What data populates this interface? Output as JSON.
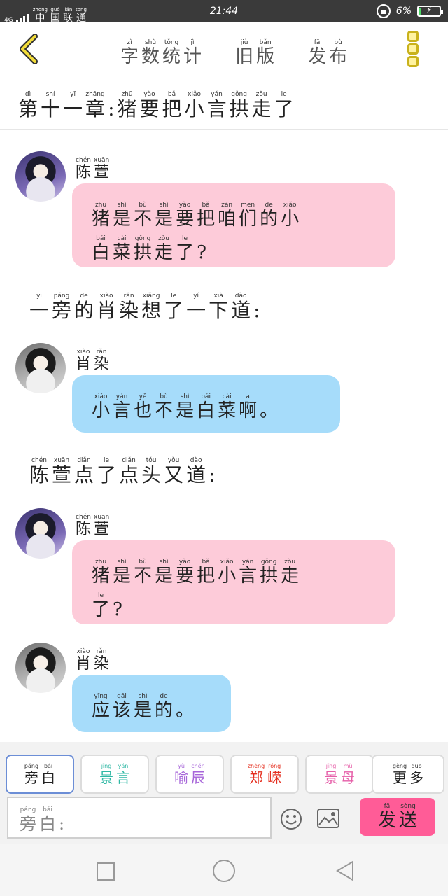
{
  "status_bar": {
    "network": "4G",
    "carrier": [
      {
        "p": "zhōng",
        "c": "中"
      },
      {
        "p": "guó",
        "c": "国"
      },
      {
        "p": "lián",
        "c": "联"
      },
      {
        "p": "tōng",
        "c": "通"
      }
    ],
    "time": "21:44",
    "battery": "6%",
    "battery_level": 0.06
  },
  "header": {
    "actions": [
      {
        "id": "word-count",
        "chars": [
          {
            "p": "zì",
            "c": "字"
          },
          {
            "p": "shù",
            "c": "数"
          },
          {
            "p": "tǒng",
            "c": "统"
          },
          {
            "p": "jì",
            "c": "计"
          }
        ]
      },
      {
        "id": "old-version",
        "chars": [
          {
            "p": "jiù",
            "c": "旧"
          },
          {
            "p": "bǎn",
            "c": "版"
          }
        ]
      },
      {
        "id": "publish",
        "chars": [
          {
            "p": "fā",
            "c": "发"
          },
          {
            "p": "bù",
            "c": "布"
          }
        ]
      }
    ],
    "chapter_title": [
      {
        "p": "dì",
        "c": "第"
      },
      {
        "p": "shí",
        "c": "十"
      },
      {
        "p": "yī",
        "c": "一"
      },
      {
        "p": "zhāng",
        "c": "章"
      },
      {
        "p": "",
        "c": ":"
      },
      {
        "p": "zhū",
        "c": "猪"
      },
      {
        "p": "yào",
        "c": "要"
      },
      {
        "p": "bǎ",
        "c": "把"
      },
      {
        "p": "xiǎo",
        "c": "小"
      },
      {
        "p": "yán",
        "c": "言"
      },
      {
        "p": "gǒng",
        "c": "拱"
      },
      {
        "p": "zǒu",
        "c": "走"
      },
      {
        "p": "le",
        "c": "了"
      }
    ]
  },
  "messages": [
    {
      "type": "chat",
      "color": "pink",
      "avatar": "purple",
      "speaker": [
        {
          "p": "chén",
          "c": "陈"
        },
        {
          "p": "xuān",
          "c": "萱"
        }
      ],
      "lines": [
        [
          {
            "p": "zhū",
            "c": "猪"
          },
          {
            "p": "shì",
            "c": "是"
          },
          {
            "p": "bù",
            "c": "不"
          },
          {
            "p": "shì",
            "c": "是"
          },
          {
            "p": "yào",
            "c": "要"
          },
          {
            "p": "bǎ",
            "c": "把"
          },
          {
            "p": "zán",
            "c": "咱"
          },
          {
            "p": "men",
            "c": "们"
          },
          {
            "p": "de",
            "c": "的"
          },
          {
            "p": "xiǎo",
            "c": "小"
          }
        ],
        [
          {
            "p": "bái",
            "c": "白"
          },
          {
            "p": "cài",
            "c": "菜"
          },
          {
            "p": "gǒng",
            "c": "拱"
          },
          {
            "p": "zǒu",
            "c": "走"
          },
          {
            "p": "le",
            "c": "了"
          },
          {
            "p": "",
            "c": "?"
          }
        ]
      ]
    },
    {
      "type": "narration",
      "lines": [
        [
          {
            "p": "yī",
            "c": "一"
          },
          {
            "p": "páng",
            "c": "旁"
          },
          {
            "p": "de",
            "c": "的"
          },
          {
            "p": "xiào",
            "c": "肖"
          },
          {
            "p": "rǎn",
            "c": "染"
          },
          {
            "p": "xiǎng",
            "c": "想"
          },
          {
            "p": "le",
            "c": "了"
          },
          {
            "p": "yí",
            "c": "一"
          },
          {
            "p": "xià",
            "c": "下"
          },
          {
            "p": "dào",
            "c": "道"
          },
          {
            "p": "",
            "c": ":"
          }
        ]
      ]
    },
    {
      "type": "chat",
      "color": "blue",
      "avatar": "gray",
      "speaker": [
        {
          "p": "xiào",
          "c": "肖"
        },
        {
          "p": "rǎn",
          "c": "染"
        }
      ],
      "lines": [
        [
          {
            "p": "xiǎo",
            "c": "小"
          },
          {
            "p": "yán",
            "c": "言"
          },
          {
            "p": "yě",
            "c": "也"
          },
          {
            "p": "bù",
            "c": "不"
          },
          {
            "p": "shì",
            "c": "是"
          },
          {
            "p": "bái",
            "c": "白"
          },
          {
            "p": "cài",
            "c": "菜"
          },
          {
            "p": "a",
            "c": "啊"
          },
          {
            "p": "",
            "c": "。"
          }
        ]
      ]
    },
    {
      "type": "narration",
      "lines": [
        [
          {
            "p": "chén",
            "c": "陈"
          },
          {
            "p": "xuān",
            "c": "萱"
          },
          {
            "p": "diǎn",
            "c": "点"
          },
          {
            "p": "le",
            "c": "了"
          },
          {
            "p": "diǎn",
            "c": "点"
          },
          {
            "p": "tóu",
            "c": "头"
          },
          {
            "p": "yòu",
            "c": "又"
          },
          {
            "p": "dào",
            "c": "道"
          },
          {
            "p": "",
            "c": ":"
          }
        ]
      ]
    },
    {
      "type": "chat",
      "color": "pink",
      "avatar": "purple",
      "speaker": [
        {
          "p": "chén",
          "c": "陈"
        },
        {
          "p": "xuān",
          "c": "萱"
        }
      ],
      "lines": [
        [
          {
            "p": "zhū",
            "c": "猪"
          },
          {
            "p": "shì",
            "c": "是"
          },
          {
            "p": "bù",
            "c": "不"
          },
          {
            "p": "shì",
            "c": "是"
          },
          {
            "p": "yào",
            "c": "要"
          },
          {
            "p": "bǎ",
            "c": "把"
          },
          {
            "p": "xiǎo",
            "c": "小"
          },
          {
            "p": "yán",
            "c": "言"
          },
          {
            "p": "gǒng",
            "c": "拱"
          },
          {
            "p": "zǒu",
            "c": "走"
          }
        ],
        [
          {
            "p": "le",
            "c": "了"
          },
          {
            "p": "",
            "c": "?"
          }
        ]
      ]
    },
    {
      "type": "chat",
      "color": "blue",
      "avatar": "gray",
      "speaker": [
        {
          "p": "xiào",
          "c": "肖"
        },
        {
          "p": "rǎn",
          "c": "染"
        }
      ],
      "lines": [
        [
          {
            "p": "yīng",
            "c": "应"
          },
          {
            "p": "gāi",
            "c": "该"
          },
          {
            "p": "shì",
            "c": "是"
          },
          {
            "p": "de",
            "c": "的"
          },
          {
            "p": "",
            "c": "。"
          }
        ]
      ]
    }
  ],
  "roles": [
    {
      "id": "narration",
      "color": "#333333",
      "chars": [
        {
          "p": "páng",
          "c": "旁"
        },
        {
          "p": "bái",
          "c": "白"
        }
      ]
    },
    {
      "id": "jing-yan",
      "color": "#2fb8a4",
      "chars": [
        {
          "p": "jǐng",
          "c": "景"
        },
        {
          "p": "yán",
          "c": "言"
        }
      ]
    },
    {
      "id": "yu-chen",
      "color": "#a766d9",
      "chars": [
        {
          "p": "yù",
          "c": "喻"
        },
        {
          "p": "chén",
          "c": "辰"
        }
      ]
    },
    {
      "id": "zheng-rong",
      "color": "#e53020",
      "chars": [
        {
          "p": "zhèng",
          "c": "郑"
        },
        {
          "p": "róng",
          "c": "嵘"
        }
      ]
    },
    {
      "id": "jing-mu",
      "color": "#e65ea8",
      "chars": [
        {
          "p": "jǐng",
          "c": "景"
        },
        {
          "p": "mǔ",
          "c": "母"
        }
      ]
    },
    {
      "id": "more",
      "color": "#333333",
      "chars": [
        {
          "p": "gèng",
          "c": "更"
        },
        {
          "p": "duō",
          "c": "多"
        }
      ]
    }
  ],
  "input": {
    "prefix": [
      {
        "p": "páng",
        "c": "旁"
      },
      {
        "p": "bái",
        "c": "白"
      },
      {
        "p": "",
        "c": ":"
      }
    ]
  },
  "send": {
    "chars": [
      {
        "p": "fā",
        "c": "发"
      },
      {
        "p": "sòng",
        "c": "送"
      }
    ],
    "color": "#ff5c97"
  },
  "colors": {
    "pink_bubble": "#fdcbd9",
    "blue_bubble": "#a6dcfa",
    "menu_accent": "#c9b21c"
  }
}
